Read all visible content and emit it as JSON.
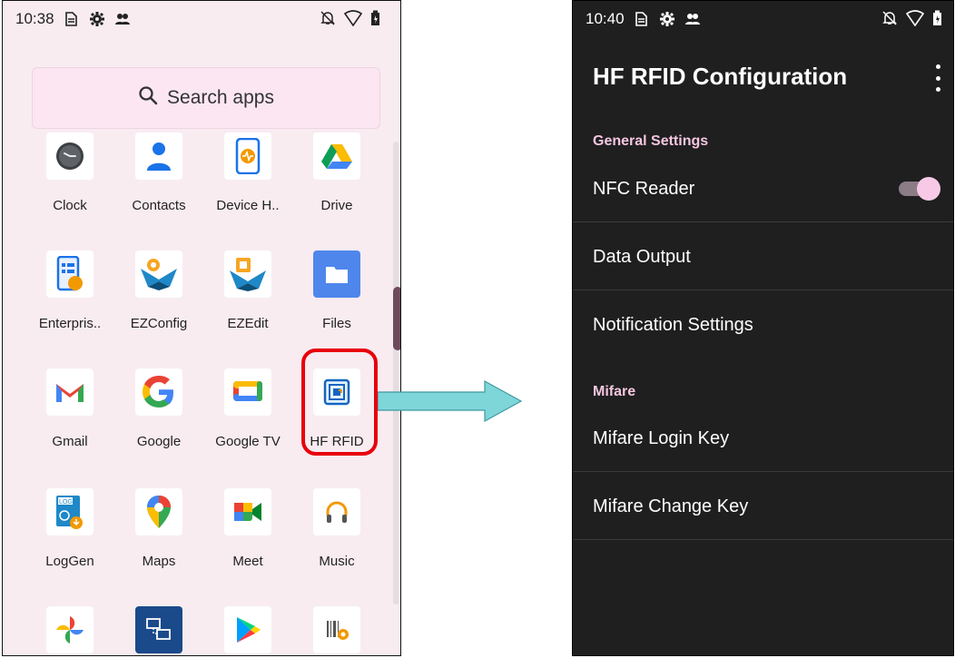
{
  "left_screen": {
    "status": {
      "time": "10:38"
    },
    "search": {
      "placeholder": "Search apps"
    },
    "apps": [
      {
        "label": "Clock",
        "icon": "clock-icon"
      },
      {
        "label": "Contacts",
        "icon": "contacts-icon"
      },
      {
        "label": "Device H..",
        "icon": "device-health-icon"
      },
      {
        "label": "Drive",
        "icon": "drive-icon"
      },
      {
        "label": "Enterpris..",
        "icon": "enterprise-icon"
      },
      {
        "label": "EZConfig",
        "icon": "ezconfig-icon"
      },
      {
        "label": "EZEdit",
        "icon": "ezedit-icon"
      },
      {
        "label": "Files",
        "icon": "files-icon"
      },
      {
        "label": "Gmail",
        "icon": "gmail-icon"
      },
      {
        "label": "Google",
        "icon": "google-icon"
      },
      {
        "label": "Google TV",
        "icon": "google-tv-icon"
      },
      {
        "label": "HF RFID",
        "icon": "hf-rfid-icon"
      },
      {
        "label": "LogGen",
        "icon": "loggen-icon"
      },
      {
        "label": "Maps",
        "icon": "maps-icon"
      },
      {
        "label": "Meet",
        "icon": "meet-icon"
      },
      {
        "label": "Music",
        "icon": "music-icon"
      },
      {
        "label": "",
        "icon": "photos-icon"
      },
      {
        "label": "",
        "icon": "remote-desktop-icon"
      },
      {
        "label": "",
        "icon": "play-store-icon"
      },
      {
        "label": "",
        "icon": "barcode-icon"
      }
    ],
    "highlight_color": "#e8000b"
  },
  "arrow": {
    "color": "#7fd6d9"
  },
  "right_screen": {
    "status": {
      "time": "10:40"
    },
    "title": "HF RFID Configuration",
    "sections": [
      {
        "header": "General Settings",
        "items": [
          "NFC Reader",
          "Data Output",
          "Notification Settings"
        ]
      },
      {
        "header": "Mifare",
        "items": [
          "Mifare Login Key",
          "Mifare Change Key"
        ]
      }
    ],
    "nfc_reader_enabled": true,
    "accent_color": "#f4c6e1"
  }
}
